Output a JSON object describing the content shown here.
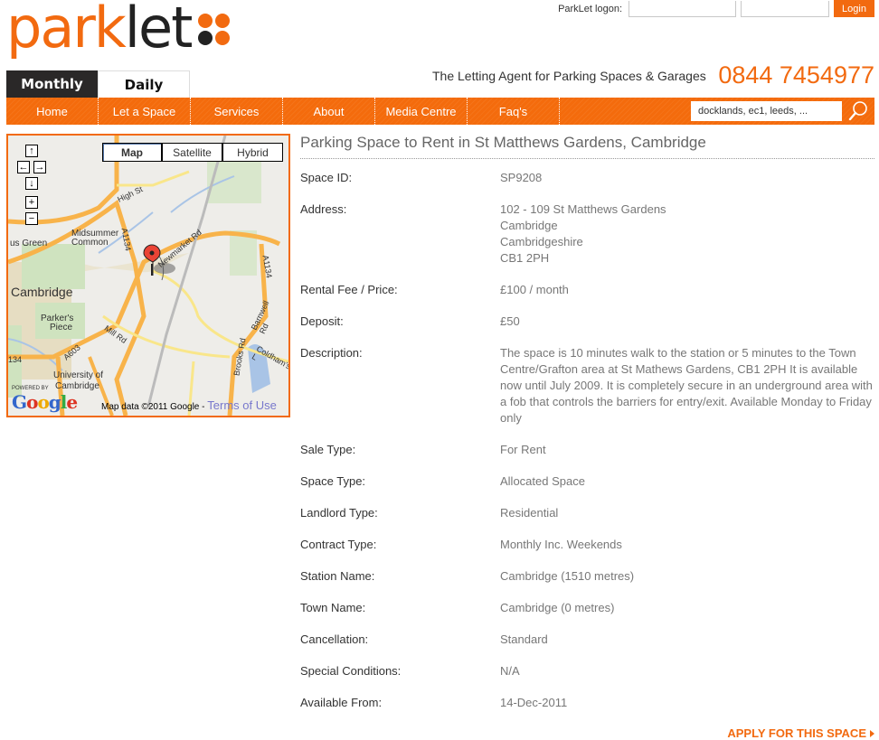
{
  "brand": {
    "name_orange": "park",
    "name_dark": "let",
    "accent": "#f26a10"
  },
  "logon": {
    "label": "ParkLet logon:",
    "username_value": "",
    "password_value": "",
    "login_label": "Login"
  },
  "tabs": [
    {
      "label": "Monthly",
      "active": true
    },
    {
      "label": "Daily",
      "active": false
    }
  ],
  "tagline": "The Letting Agent for Parking Spaces & Garages",
  "phone": "0844 7454977",
  "nav": [
    {
      "label": "Home"
    },
    {
      "label": "Let a Space"
    },
    {
      "label": "Services"
    },
    {
      "label": "About"
    },
    {
      "label": "Media Centre"
    },
    {
      "label": "Faq's"
    }
  ],
  "search": {
    "value": "docklands, ec1, leeds, ..."
  },
  "map": {
    "types": [
      "Map",
      "Satellite",
      "Hybrid"
    ],
    "selected_type": "Map",
    "controls": {
      "up": "↑",
      "left": "←",
      "right": "→",
      "down": "↓",
      "zoom_in": "+",
      "zoom_out": "−"
    },
    "labels": {
      "cambridge": "Cambridge",
      "midsummer": "Midsummer",
      "common": "Common",
      "green": "us Green",
      "parkers": "Parker's",
      "piece": "Piece",
      "univ1": "University of",
      "univ2": "Cambridge",
      "high_st": "High St",
      "newmarket": "Newmarket Rd",
      "mill_rd": "Mill Rd",
      "a1134": "A1134",
      "a1134b": "A1134",
      "a603": "A603",
      "brooks": "Brooks Rd",
      "barnwell": "Barnwell Rd",
      "coldhams": "Coldham's L",
      "a134": "134"
    },
    "powered_by": "POWERED BY",
    "google": "Google",
    "copyright": "Map data ©2011 Google - ",
    "terms": "Terms of Use"
  },
  "listing": {
    "title": "Parking Space to Rent in St Matthews Gardens, Cambridge",
    "fields": [
      {
        "label": "Space ID:",
        "value": "SP9208"
      },
      {
        "label": "Address:",
        "value": [
          "102 - 109 St Matthews Gardens",
          "Cambridge",
          "Cambridgeshire",
          "CB1 2PH"
        ]
      },
      {
        "label": "Rental Fee / Price:",
        "value": "£100 / month"
      },
      {
        "label": "Deposit:",
        "value": "£50"
      },
      {
        "label": "Description:",
        "value": "The space is 10 minutes walk to the station or 5 minutes to the Town Centre/Grafton area at St Mathews Gardens, CB1 2PH It is available now until July 2009. It is completely secure in an underground area with a fob that controls the barriers for entry/exit. Available Monday to Friday only"
      },
      {
        "label": "Sale Type:",
        "value": "For Rent"
      },
      {
        "label": "Space Type:",
        "value": "Allocated Space"
      },
      {
        "label": "Landlord Type:",
        "value": "Residential"
      },
      {
        "label": "Contract Type:",
        "value": "Monthly Inc. Weekends"
      },
      {
        "label": "Station Name:",
        "value": "Cambridge (1510 metres)"
      },
      {
        "label": "Town Name:",
        "value": "Cambridge (0 metres)"
      },
      {
        "label": "Cancellation:",
        "value": "Standard"
      },
      {
        "label": "Special Conditions:",
        "value": "N/A"
      },
      {
        "label": "Available From:",
        "value": "14-Dec-2011"
      }
    ],
    "apply_label": "APPLY FOR THIS SPACE"
  }
}
